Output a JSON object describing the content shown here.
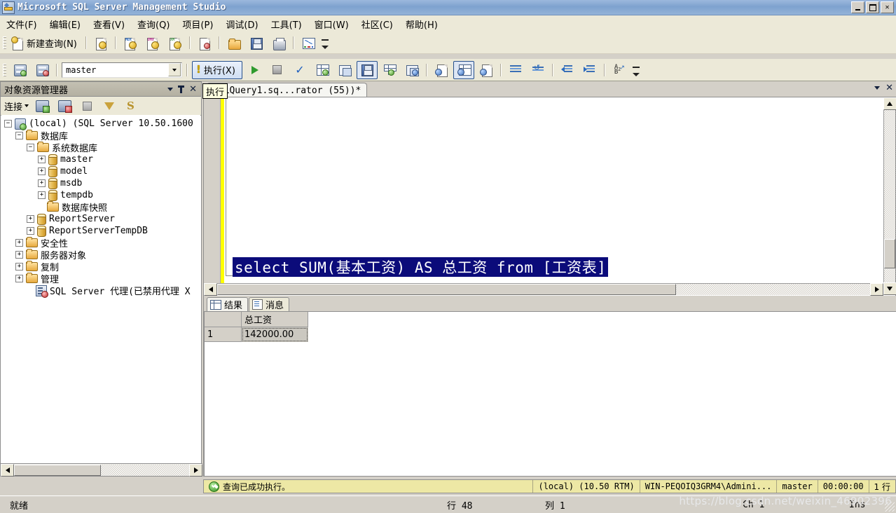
{
  "window": {
    "title": "Microsoft SQL Server Management Studio",
    "app_icon": "ssms-icon",
    "minimize": "_",
    "maximize": "□",
    "close": "✕"
  },
  "menu": {
    "items": [
      {
        "label": "文件(F)",
        "name": "menu-file"
      },
      {
        "label": "编辑(E)",
        "name": "menu-edit"
      },
      {
        "label": "查看(V)",
        "name": "menu-view"
      },
      {
        "label": "查询(Q)",
        "name": "menu-query"
      },
      {
        "label": "项目(P)",
        "name": "menu-project"
      },
      {
        "label": "调试(D)",
        "name": "menu-debug"
      },
      {
        "label": "工具(T)",
        "name": "menu-tools"
      },
      {
        "label": "窗口(W)",
        "name": "menu-window"
      },
      {
        "label": "社区(C)",
        "name": "menu-community"
      },
      {
        "label": "帮助(H)",
        "name": "menu-help"
      }
    ]
  },
  "toolbar_standard": {
    "new_query_label": "新建查询(N)",
    "icons": [
      "new-query-icon",
      "new-file-icon",
      "mdx-query-icon",
      "dmx-query-icon",
      "xmla-query-icon",
      "analysis-file-icon",
      "open-file-icon",
      "save-icon",
      "print-icon",
      "activity-monitor-icon"
    ],
    "overflow": "toolbar-overflow-chevron"
  },
  "toolbar_query": {
    "database_value": "master",
    "database_placeholder": "master",
    "execute_label": "执行(X)",
    "execute_icon": "exclamation-icon",
    "icons": [
      "connect-icon",
      "disconnect-icon",
      "debug-run-icon",
      "stop-icon",
      "parse-check-icon",
      "display-estimated-plan-icon",
      "query-options-icon",
      "include-actual-plan-icon",
      "client-statistics-icon",
      "results-to-text-icon",
      "results-to-grid-icon",
      "results-to-file-icon",
      "comment-icon",
      "uncomment-icon",
      "decrease-indent-icon",
      "increase-indent-icon",
      "specify-values-icon"
    ],
    "overflow": "toolbar-overflow-chevron"
  },
  "object_explorer": {
    "title": "对象资源管理器",
    "header_buttons": [
      "dropdown-icon",
      "pin-icon",
      "close-icon"
    ],
    "toolbar": {
      "connect_label": "连接",
      "icons": [
        "connect-server-icon",
        "disconnect-server-icon",
        "stop-icon",
        "filter-icon",
        "refresh-script-icon"
      ]
    },
    "tree": [
      {
        "label": "(local)  (SQL Server 10.50.1600",
        "icon": "server-icon",
        "expander": "-",
        "indent": 0,
        "name": "tree-node-server"
      },
      {
        "label": "数据库",
        "icon": "folder-icon",
        "expander": "-",
        "indent": 1,
        "name": "tree-node-databases"
      },
      {
        "label": "系统数据库",
        "icon": "folder-icon",
        "expander": "-",
        "indent": 2,
        "name": "tree-node-system-databases"
      },
      {
        "label": "master",
        "icon": "database-icon",
        "expander": "+",
        "indent": 3,
        "name": "tree-node-master"
      },
      {
        "label": "model",
        "icon": "database-icon",
        "expander": "+",
        "indent": 3,
        "name": "tree-node-model"
      },
      {
        "label": "msdb",
        "icon": "database-icon",
        "expander": "+",
        "indent": 3,
        "name": "tree-node-msdb"
      },
      {
        "label": "tempdb",
        "icon": "database-icon",
        "expander": "+",
        "indent": 3,
        "name": "tree-node-tempdb"
      },
      {
        "label": "数据库快照",
        "icon": "folder-icon",
        "expander": "",
        "indent": 2,
        "name": "tree-node-database-snapshots"
      },
      {
        "label": "ReportServer",
        "icon": "database-icon",
        "expander": "+",
        "indent": 2,
        "name": "tree-node-reportserver"
      },
      {
        "label": "ReportServerTempDB",
        "icon": "database-icon",
        "expander": "+",
        "indent": 2,
        "name": "tree-node-reportservertempdb"
      },
      {
        "label": "安全性",
        "icon": "folder-icon",
        "expander": "+",
        "indent": 1,
        "name": "tree-node-security"
      },
      {
        "label": "服务器对象",
        "icon": "folder-icon",
        "expander": "+",
        "indent": 1,
        "name": "tree-node-server-objects"
      },
      {
        "label": "复制",
        "icon": "folder-icon",
        "expander": "+",
        "indent": 1,
        "name": "tree-node-replication"
      },
      {
        "label": "管理",
        "icon": "folder-icon",
        "expander": "+",
        "indent": 1,
        "name": "tree-node-management"
      },
      {
        "label": "SQL Server 代理(已禁用代理 X",
        "icon": "agent-icon",
        "expander": "",
        "indent": 1,
        "name": "tree-node-sql-server-agent"
      }
    ]
  },
  "tooltip": {
    "text": "执行"
  },
  "editor": {
    "tab_label": "SQLQuery1.sq...rator (55))*",
    "tab_buttons": [
      "dropdown-icon",
      "close-icon"
    ],
    "sql_text": "select SUM(基本工资) AS 总工资 from [工资表]"
  },
  "results": {
    "tabs": [
      {
        "label": "结果",
        "icon": "grid-icon",
        "active": true,
        "name": "tab-results"
      },
      {
        "label": "消息",
        "icon": "messages-icon",
        "active": false,
        "name": "tab-messages"
      }
    ],
    "columns": [
      "",
      "总工资"
    ],
    "rows": [
      {
        "num": "1",
        "values": [
          "142000.00"
        ]
      }
    ]
  },
  "query_status": {
    "message": "查询已成功执行。",
    "server": "(local)  (10.50 RTM)",
    "user": "WIN-PEQOIQ3GRM4\\Admini...",
    "database": "master",
    "elapsed": "00:00:00",
    "rows": "1 行"
  },
  "app_status": {
    "ready": "就绪",
    "line": "行 48",
    "column": "列 1",
    "character": "Ch 1",
    "insert_mode": "Ins"
  },
  "watermark": {
    "text": "https://blog.csdn.net/weixin_46902396"
  },
  "colors": {
    "title_bar": "#7ea2cf",
    "menu_bg": "#ece9d8",
    "panel_bg": "#d4d0c8",
    "selection_bg": "#0b0b7a",
    "status_bar": "#ede8a5",
    "change_marker": "#ffff00"
  }
}
